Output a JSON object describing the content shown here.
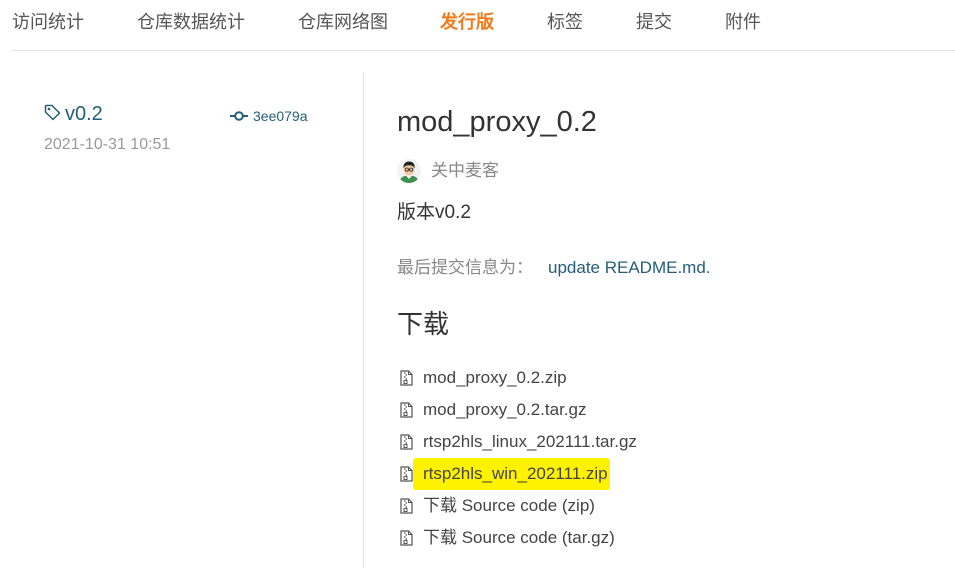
{
  "nav": {
    "tabs": [
      {
        "label": "访问统计",
        "active": false
      },
      {
        "label": "仓库数据统计",
        "active": false
      },
      {
        "label": "仓库网络图",
        "active": false
      },
      {
        "label": "发行版",
        "active": true
      },
      {
        "label": "标签",
        "active": false
      },
      {
        "label": "提交",
        "active": false
      },
      {
        "label": "附件",
        "active": false
      }
    ]
  },
  "release": {
    "tag_icon": "tag-icon",
    "tag": "v0.2",
    "date": "2021-10-31 10:51",
    "commit_icon": "commit-icon",
    "commit": "3ee079a",
    "title": "mod_proxy_0.2",
    "author": "关中麦客",
    "description": "版本v0.2",
    "last_commit_label": "最后提交信息为：",
    "last_commit_message": "update README.md.",
    "downloads_heading": "下载",
    "download_icon": "file-zip-icon",
    "downloads": [
      {
        "label": "mod_proxy_0.2.zip",
        "highlighted": false
      },
      {
        "label": "mod_proxy_0.2.tar.gz",
        "highlighted": false
      },
      {
        "label": "rtsp2hls_linux_202111.tar.gz",
        "highlighted": false
      },
      {
        "label": "rtsp2hls_win_202111.zip",
        "highlighted": true
      },
      {
        "label": "下载 Source code (zip)",
        "highlighted": false
      },
      {
        "label": "下载 Source code (tar.gz)",
        "highlighted": false
      }
    ]
  },
  "colors": {
    "accent": "#f37b1d",
    "link": "#235f78",
    "highlight": "#fff200",
    "text": "#333333",
    "muted": "#999999"
  }
}
